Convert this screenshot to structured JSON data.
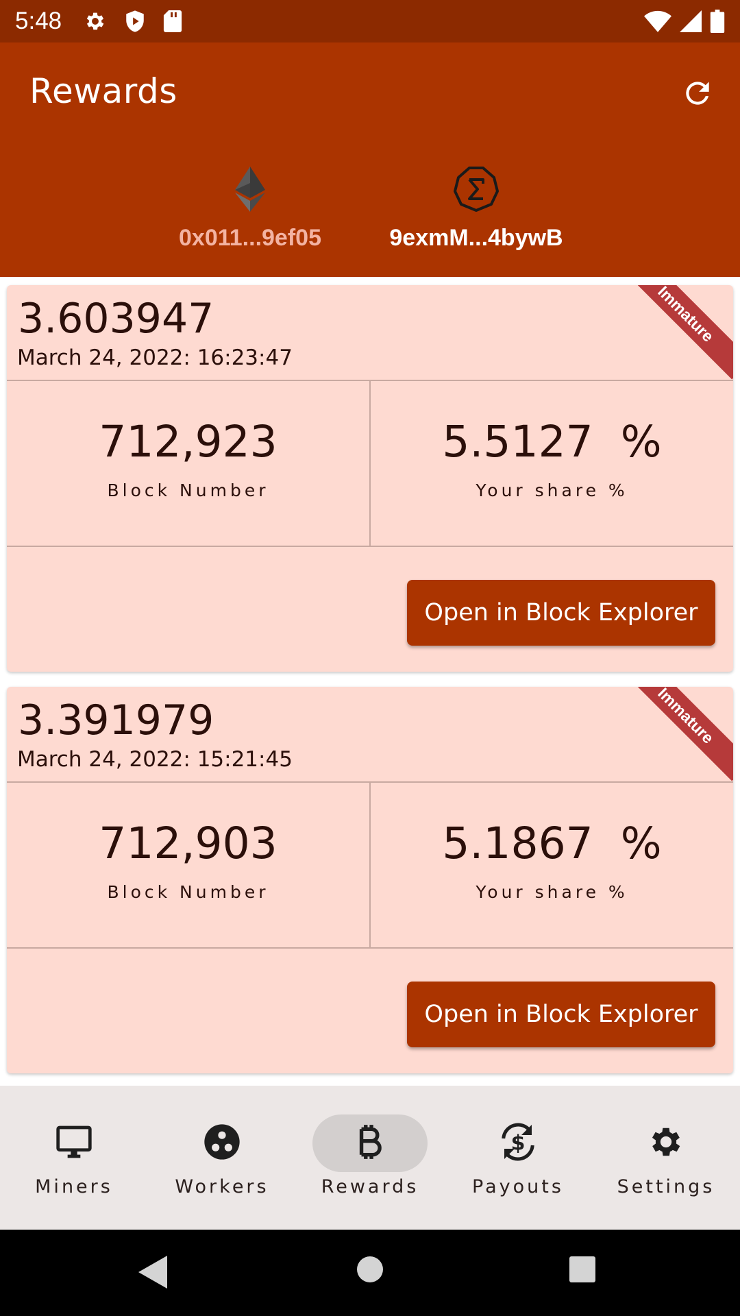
{
  "status_bar": {
    "time": "5:48",
    "left_icons": [
      "settings-icon",
      "shield-icon",
      "sd-card-icon"
    ],
    "right_icons": [
      "wifi-icon",
      "signal-icon",
      "battery-icon"
    ]
  },
  "app_bar": {
    "title": "Rewards",
    "action_icon": "refresh-icon"
  },
  "tabs": [
    {
      "label": "0x011...9ef05",
      "icon": "ethereum-icon",
      "selected": false
    },
    {
      "label": "9exmM...4bywB",
      "icon": "ergo-icon",
      "selected": true
    }
  ],
  "rewards": [
    {
      "amount": "3.603947",
      "date": "March 24, 2022: 16:23:47",
      "block_number": "712,923",
      "block_label": "Block Number",
      "share": "5.5127  %",
      "share_label": "Your share %",
      "button_label": "Open in Block Explorer",
      "badge": "Immature"
    },
    {
      "amount": "3.391979",
      "date": "March 24, 2022: 15:21:45",
      "block_number": "712,903",
      "block_label": "Block Number",
      "share": "5.1867  %",
      "share_label": "Your share %",
      "button_label": "Open in Block Explorer",
      "badge": "Immature"
    }
  ],
  "bottom_nav": [
    {
      "label": "Miners",
      "icon": "monitor-icon",
      "active": false
    },
    {
      "label": "Workers",
      "icon": "workers-icon",
      "active": false
    },
    {
      "label": "Rewards",
      "icon": "bitcoin-icon",
      "active": true
    },
    {
      "label": "Payouts",
      "icon": "payouts-icon",
      "active": false
    },
    {
      "label": "Settings",
      "icon": "gear-icon",
      "active": false
    }
  ],
  "colors": {
    "status_bar": "#8c2a00",
    "app_bar": "#ab3400",
    "card_background": "#fedad1",
    "button": "#ab3400",
    "ribbon": "#b63a3a",
    "bottom_nav": "#ece7e6"
  }
}
